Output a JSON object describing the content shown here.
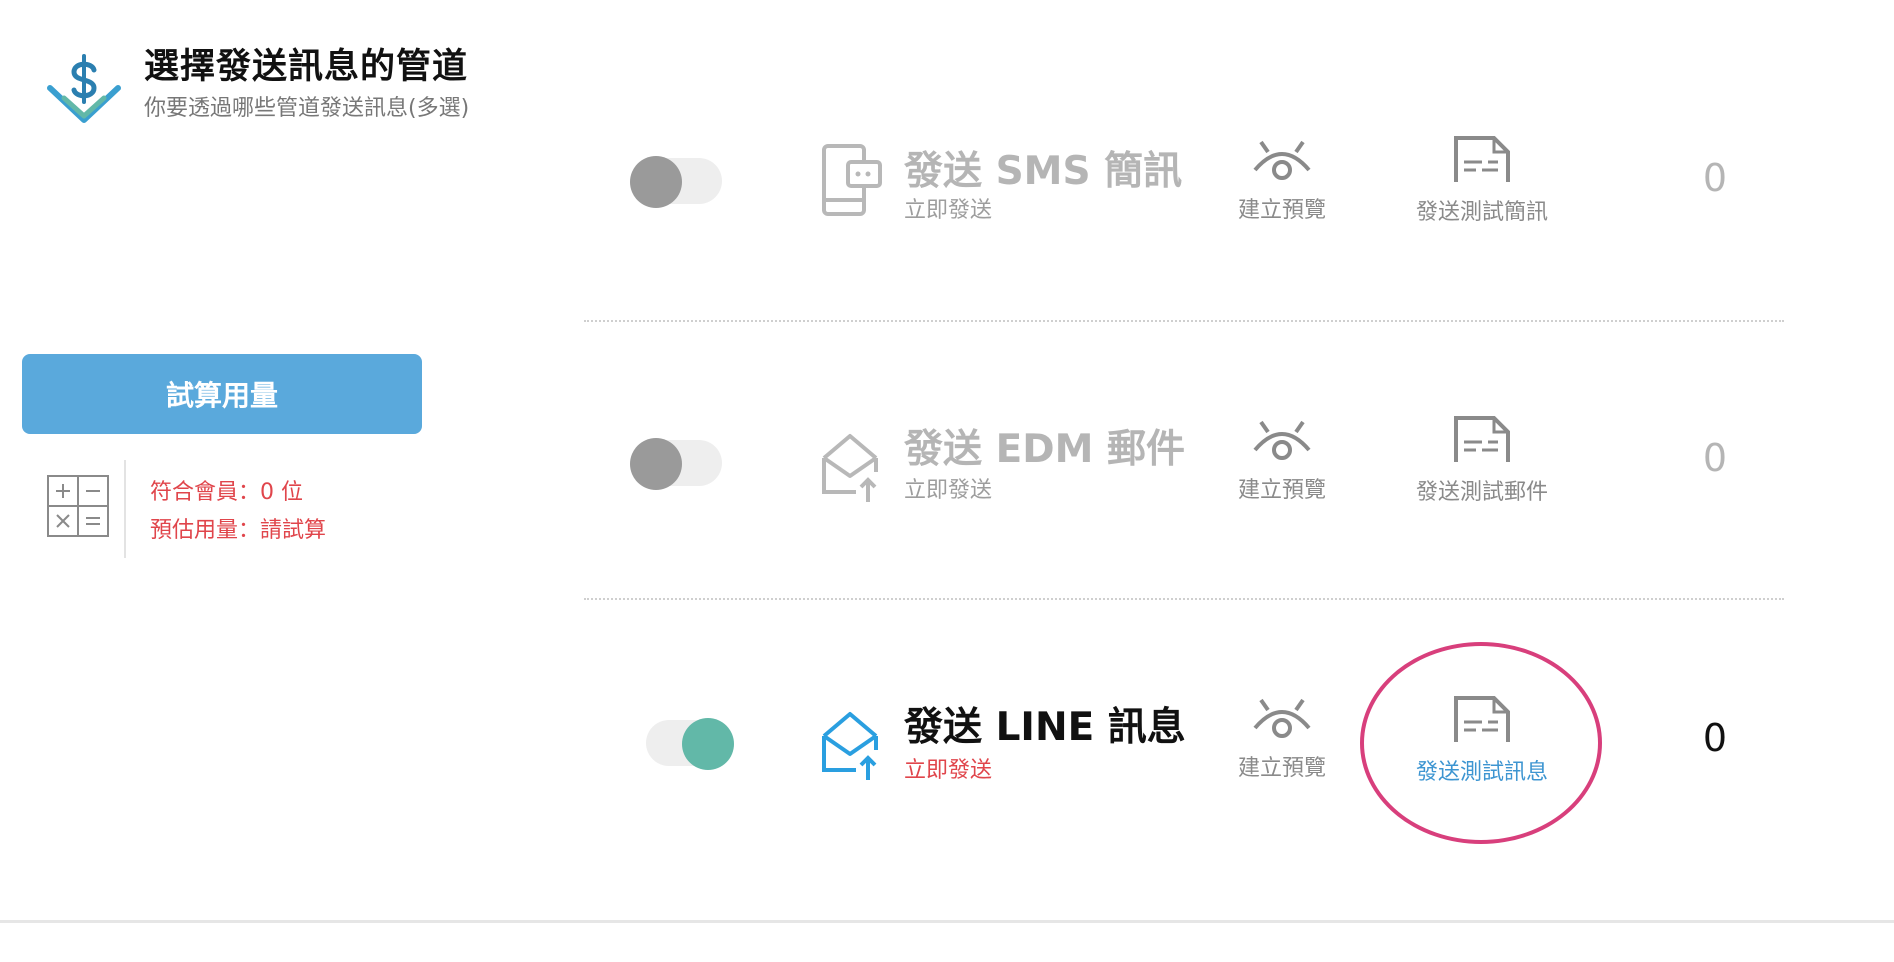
{
  "header": {
    "title": "選擇發送訊息的管道",
    "subtitle": "你要透過哪些管道發送訊息(多選)",
    "icon": "dollar-down-arrow-icon"
  },
  "calculator": {
    "button_label": "試算用量",
    "members_line": "符合會員：0 位",
    "estimate_line": "預估用量：請試算",
    "text_color": "#e0454b",
    "button_color": "#5aa9dc"
  },
  "channels": [
    {
      "title": "發送 SMS 簡訊",
      "subtitle": "立即發送",
      "enabled": false,
      "preview_label": "建立預覽",
      "test_label": "發送測試簡訊",
      "count": "0",
      "icon": "mobile-chat-icon"
    },
    {
      "title": "發送 EDM 郵件",
      "subtitle": "立即發送",
      "enabled": false,
      "preview_label": "建立預覽",
      "test_label": "發送測試郵件",
      "count": "0",
      "icon": "envelope-upload-icon"
    },
    {
      "title": "發送 LINE 訊息",
      "subtitle": "立即發送",
      "enabled": true,
      "preview_label": "建立預覽",
      "test_label": "發送測試訊息",
      "count": "0",
      "icon": "envelope-upload-icon"
    }
  ],
  "colors": {
    "toggle_on": "#62b8a8",
    "toggle_off": "#9a9a9a",
    "highlight_circle": "#d83f7c",
    "active_link": "#3d95d1"
  }
}
